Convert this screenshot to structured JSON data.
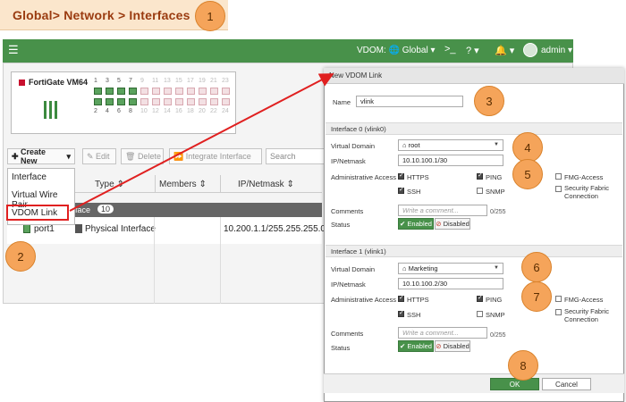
{
  "breadcrumb": {
    "text": "Global> Network > Interfaces"
  },
  "steps": [
    "1",
    "2",
    "3",
    "4",
    "5",
    "6",
    "7",
    "8"
  ],
  "topbar": {
    "menu_icon": "hamburger-icon",
    "vdom_label": "VDOM:",
    "vdom_value": "Global",
    "cli_icon": ">_",
    "help_icon": "?",
    "bell_icon": "bell-icon",
    "user": "admin"
  },
  "device": {
    "name": "FortiGate VM64",
    "top_numbers": [
      "1",
      "3",
      "5",
      "7",
      "9",
      "11",
      "13",
      "15",
      "17",
      "19",
      "21",
      "23"
    ],
    "bottom_numbers": [
      "2",
      "4",
      "6",
      "8",
      "10",
      "12",
      "14",
      "16",
      "18",
      "20",
      "22",
      "24"
    ]
  },
  "toolbar": {
    "create_label": "Create New",
    "edit_label": "Edit",
    "delete_label": "Delete",
    "integrate_label": "Integrate Interface",
    "search_placeholder": "Search"
  },
  "create_menu": [
    "Interface",
    "Virtual Wire Pair",
    "VDOM Link"
  ],
  "table": {
    "headers": [
      "Type",
      "Members",
      "IP/Netmask"
    ],
    "group_text": "face",
    "group_count": "10",
    "rows": [
      {
        "name": "port1",
        "type": "Physical Interface",
        "ip": "10.200.1.1/255.255.255.0"
      }
    ]
  },
  "dialog": {
    "title": "New VDOM Link",
    "name_label": "Name",
    "name_value": "vlink",
    "iface0": {
      "heading": "Interface 0 (vlink0)",
      "vdom_label": "Virtual Domain",
      "vdom_value": "root",
      "ip_label": "IP/Netmask",
      "ip_value": "10.10.100.1/30",
      "access_label": "Administrative Access",
      "https": "HTTPS",
      "ping": "PING",
      "fmg": "FMG-Access",
      "ssh": "SSH",
      "snmp": "SNMP",
      "fabric": "Security Fabric Connection",
      "comments_label": "Comments",
      "comments_placeholder": "Write a comment...",
      "counter": "0/255",
      "status_label": "Status",
      "enabled": "Enabled",
      "disabled": "Disabled"
    },
    "iface1": {
      "heading": "Interface 1 (vlink1)",
      "vdom_label": "Virtual Domain",
      "vdom_value": "Marketing",
      "ip_label": "IP/Netmask",
      "ip_value": "10.10.100.2/30",
      "access_label": "Administrative Access",
      "https": "HTTPS",
      "ping": "PING",
      "fmg": "FMG-Access",
      "ssh": "SSH",
      "snmp": "SNMP",
      "fabric": "Security Fabric Connection",
      "comments_label": "Comments",
      "comments_placeholder": "Write a comment...",
      "counter": "0/255",
      "status_label": "Status",
      "enabled": "Enabled",
      "disabled": "Disabled"
    },
    "ok_label": "OK",
    "cancel_label": "Cancel"
  },
  "colors": {
    "accent": "#48914a",
    "highlight": "#e02020",
    "step": "#f5a45a"
  }
}
